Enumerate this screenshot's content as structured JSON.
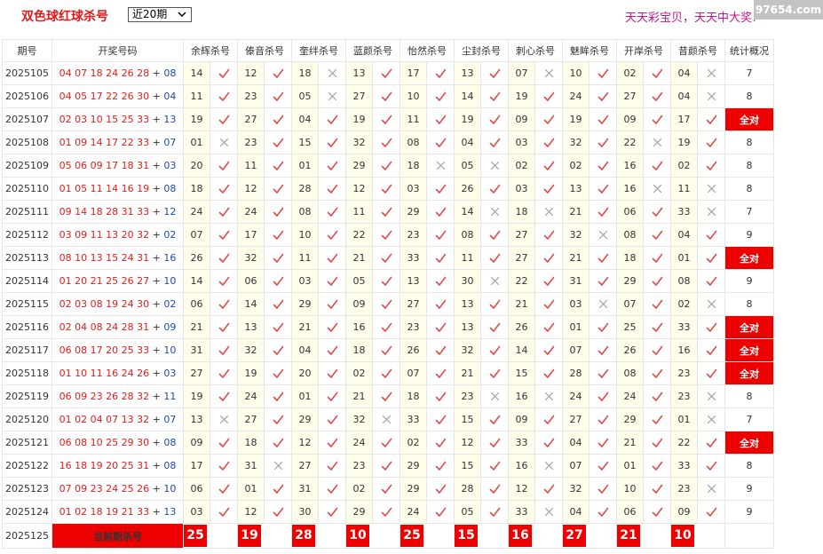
{
  "header": {
    "title": "双色球红球杀号",
    "period_select": "近20期",
    "ticker": "天天彩宝贝，天天中大奖!",
    "watermark": "97654.com"
  },
  "columns": [
    "期号",
    "开奖号码",
    "余辉杀号",
    "傣音杀号",
    "奎绊杀号",
    "蓝颜杀号",
    "怡然杀号",
    "尘封杀号",
    "刺心杀号",
    "魅眸杀号",
    "开岸杀号",
    "昔颜杀号",
    "统计概况"
  ],
  "rows": [
    {
      "issue": "2025105",
      "reds": "04 07 18 24 26 28",
      "blue": "08",
      "kills": [
        [
          "14",
          true
        ],
        [
          "12",
          true
        ],
        [
          "18",
          false
        ],
        [
          "13",
          true
        ],
        [
          "17",
          true
        ],
        [
          "13",
          true
        ],
        [
          "07",
          false
        ],
        [
          "10",
          true
        ],
        [
          "02",
          true
        ],
        [
          "04",
          false
        ]
      ],
      "stat": "7",
      "full": false
    },
    {
      "issue": "2025106",
      "reds": "04 05 17 22 26 30",
      "blue": "04",
      "kills": [
        [
          "11",
          true
        ],
        [
          "23",
          true
        ],
        [
          "05",
          false
        ],
        [
          "27",
          true
        ],
        [
          "10",
          true
        ],
        [
          "14",
          true
        ],
        [
          "19",
          true
        ],
        [
          "24",
          true
        ],
        [
          "27",
          true
        ],
        [
          "04",
          false
        ]
      ],
      "stat": "8",
      "full": false
    },
    {
      "issue": "2025107",
      "reds": "02 03 10 15 25 33",
      "blue": "13",
      "kills": [
        [
          "19",
          true
        ],
        [
          "27",
          true
        ],
        [
          "04",
          true
        ],
        [
          "19",
          true
        ],
        [
          "11",
          true
        ],
        [
          "19",
          true
        ],
        [
          "09",
          true
        ],
        [
          "19",
          true
        ],
        [
          "09",
          true
        ],
        [
          "17",
          true
        ]
      ],
      "stat": "全对",
      "full": true
    },
    {
      "issue": "2025108",
      "reds": "01 09 14 17 22 33",
      "blue": "07",
      "kills": [
        [
          "01",
          false
        ],
        [
          "23",
          true
        ],
        [
          "15",
          true
        ],
        [
          "32",
          true
        ],
        [
          "08",
          true
        ],
        [
          "04",
          true
        ],
        [
          "03",
          true
        ],
        [
          "32",
          true
        ],
        [
          "22",
          false
        ],
        [
          "19",
          true
        ]
      ],
      "stat": "8",
      "full": false
    },
    {
      "issue": "2025109",
      "reds": "05 06 09 17 18 31",
      "blue": "03",
      "kills": [
        [
          "20",
          true
        ],
        [
          "11",
          true
        ],
        [
          "01",
          true
        ],
        [
          "29",
          true
        ],
        [
          "18",
          false
        ],
        [
          "05",
          false
        ],
        [
          "02",
          true
        ],
        [
          "02",
          true
        ],
        [
          "16",
          true
        ],
        [
          "02",
          true
        ]
      ],
      "stat": "8",
      "full": false
    },
    {
      "issue": "2025110",
      "reds": "01 05 11 14 16 19",
      "blue": "08",
      "kills": [
        [
          "18",
          true
        ],
        [
          "12",
          true
        ],
        [
          "28",
          true
        ],
        [
          "12",
          true
        ],
        [
          "03",
          true
        ],
        [
          "26",
          true
        ],
        [
          "03",
          true
        ],
        [
          "13",
          true
        ],
        [
          "16",
          false
        ],
        [
          "11",
          false
        ]
      ],
      "stat": "8",
      "full": false
    },
    {
      "issue": "2025111",
      "reds": "09 14 18 28 31 33",
      "blue": "12",
      "kills": [
        [
          "24",
          true
        ],
        [
          "24",
          true
        ],
        [
          "08",
          true
        ],
        [
          "11",
          true
        ],
        [
          "29",
          true
        ],
        [
          "14",
          false
        ],
        [
          "18",
          false
        ],
        [
          "21",
          true
        ],
        [
          "06",
          true
        ],
        [
          "33",
          false
        ]
      ],
      "stat": "7",
      "full": false
    },
    {
      "issue": "2025112",
      "reds": "03 09 11 13 20 32",
      "blue": "02",
      "kills": [
        [
          "07",
          true
        ],
        [
          "17",
          true
        ],
        [
          "10",
          true
        ],
        [
          "22",
          true
        ],
        [
          "23",
          true
        ],
        [
          "08",
          true
        ],
        [
          "27",
          true
        ],
        [
          "32",
          false
        ],
        [
          "08",
          true
        ],
        [
          "04",
          true
        ]
      ],
      "stat": "9",
      "full": false
    },
    {
      "issue": "2025113",
      "reds": "08 10 13 15 24 31",
      "blue": "16",
      "kills": [
        [
          "26",
          true
        ],
        [
          "32",
          true
        ],
        [
          "11",
          true
        ],
        [
          "21",
          true
        ],
        [
          "33",
          true
        ],
        [
          "11",
          true
        ],
        [
          "27",
          true
        ],
        [
          "21",
          true
        ],
        [
          "18",
          true
        ],
        [
          "01",
          true
        ]
      ],
      "stat": "全对",
      "full": true
    },
    {
      "issue": "2025114",
      "reds": "01 20 21 25 26 27",
      "blue": "10",
      "kills": [
        [
          "14",
          true
        ],
        [
          "06",
          true
        ],
        [
          "03",
          true
        ],
        [
          "05",
          true
        ],
        [
          "13",
          true
        ],
        [
          "30",
          false
        ],
        [
          "22",
          true
        ],
        [
          "31",
          true
        ],
        [
          "29",
          true
        ],
        [
          "08",
          true
        ]
      ],
      "stat": "9",
      "full": false
    },
    {
      "issue": "2025115",
      "reds": "02 03 08 19 24 30",
      "blue": "02",
      "kills": [
        [
          "06",
          true
        ],
        [
          "14",
          true
        ],
        [
          "29",
          true
        ],
        [
          "09",
          true
        ],
        [
          "27",
          true
        ],
        [
          "13",
          true
        ],
        [
          "21",
          true
        ],
        [
          "03",
          false
        ],
        [
          "07",
          true
        ],
        [
          "02",
          false
        ]
      ],
      "stat": "8",
      "full": false
    },
    {
      "issue": "2025116",
      "reds": "02 04 08 24 28 31",
      "blue": "09",
      "kills": [
        [
          "21",
          true
        ],
        [
          "13",
          true
        ],
        [
          "21",
          true
        ],
        [
          "16",
          true
        ],
        [
          "23",
          true
        ],
        [
          "13",
          true
        ],
        [
          "26",
          true
        ],
        [
          "01",
          true
        ],
        [
          "25",
          true
        ],
        [
          "33",
          true
        ]
      ],
      "stat": "全对",
      "full": true
    },
    {
      "issue": "2025117",
      "reds": "06 08 17 20 25 33",
      "blue": "10",
      "kills": [
        [
          "31",
          true
        ],
        [
          "32",
          true
        ],
        [
          "04",
          true
        ],
        [
          "18",
          true
        ],
        [
          "26",
          true
        ],
        [
          "32",
          true
        ],
        [
          "14",
          true
        ],
        [
          "07",
          true
        ],
        [
          "26",
          true
        ],
        [
          "16",
          true
        ]
      ],
      "stat": "全对",
      "full": true
    },
    {
      "issue": "2025118",
      "reds": "01 10 11 16 24 26",
      "blue": "03",
      "kills": [
        [
          "27",
          true
        ],
        [
          "19",
          true
        ],
        [
          "20",
          true
        ],
        [
          "02",
          true
        ],
        [
          "07",
          true
        ],
        [
          "21",
          true
        ],
        [
          "15",
          true
        ],
        [
          "28",
          true
        ],
        [
          "08",
          true
        ],
        [
          "23",
          true
        ]
      ],
      "stat": "全对",
      "full": true
    },
    {
      "issue": "2025119",
      "reds": "06 09 23 26 28 32",
      "blue": "11",
      "kills": [
        [
          "19",
          true
        ],
        [
          "24",
          true
        ],
        [
          "01",
          true
        ],
        [
          "21",
          true
        ],
        [
          "18",
          true
        ],
        [
          "23",
          false
        ],
        [
          "16",
          false
        ],
        [
          "24",
          true
        ],
        [
          "24",
          true
        ],
        [
          "23",
          false
        ]
      ],
      "stat": "8",
      "full": false
    },
    {
      "issue": "2025120",
      "reds": "01 02 04 07 13 32",
      "blue": "07",
      "kills": [
        [
          "13",
          false
        ],
        [
          "27",
          true
        ],
        [
          "29",
          true
        ],
        [
          "32",
          false
        ],
        [
          "33",
          true
        ],
        [
          "15",
          true
        ],
        [
          "09",
          true
        ],
        [
          "27",
          true
        ],
        [
          "29",
          true
        ],
        [
          "01",
          false
        ]
      ],
      "stat": "7",
      "full": false
    },
    {
      "issue": "2025121",
      "reds": "06 08 10 25 29 30",
      "blue": "08",
      "kills": [
        [
          "09",
          true
        ],
        [
          "18",
          true
        ],
        [
          "12",
          true
        ],
        [
          "24",
          true
        ],
        [
          "02",
          true
        ],
        [
          "12",
          true
        ],
        [
          "33",
          true
        ],
        [
          "04",
          true
        ],
        [
          "21",
          true
        ],
        [
          "22",
          true
        ]
      ],
      "stat": "全对",
      "full": true
    },
    {
      "issue": "2025122",
      "reds": "16 18 19 20 25 31",
      "blue": "08",
      "kills": [
        [
          "17",
          true
        ],
        [
          "31",
          false
        ],
        [
          "27",
          true
        ],
        [
          "23",
          true
        ],
        [
          "29",
          true
        ],
        [
          "15",
          true
        ],
        [
          "16",
          false
        ],
        [
          "07",
          true
        ],
        [
          "01",
          true
        ],
        [
          "33",
          true
        ]
      ],
      "stat": "8",
      "full": false
    },
    {
      "issue": "2025123",
      "reds": "07 09 23 24 25 26",
      "blue": "10",
      "kills": [
        [
          "06",
          true
        ],
        [
          "01",
          true
        ],
        [
          "31",
          true
        ],
        [
          "02",
          true
        ],
        [
          "29",
          true
        ],
        [
          "28",
          true
        ],
        [
          "12",
          true
        ],
        [
          "32",
          true
        ],
        [
          "10",
          true
        ],
        [
          "23",
          false
        ]
      ],
      "stat": "9",
      "full": false
    },
    {
      "issue": "2025124",
      "reds": "01 02 18 19 21 33",
      "blue": "13",
      "kills": [
        [
          "03",
          true
        ],
        [
          "12",
          true
        ],
        [
          "30",
          true
        ],
        [
          "29",
          true
        ],
        [
          "24",
          true
        ],
        [
          "05",
          true
        ],
        [
          "33",
          false
        ],
        [
          "04",
          true
        ],
        [
          "06",
          true
        ],
        [
          "09",
          true
        ]
      ],
      "stat": "9",
      "full": false
    }
  ],
  "current": {
    "issue": "2025125",
    "label": "当前期杀号",
    "kills": [
      "25",
      "19",
      "28",
      "10",
      "25",
      "15",
      "16",
      "27",
      "21",
      "10"
    ]
  },
  "colors": {
    "red": "#e0201b",
    "blue": "#1f48b8",
    "highlight": "#ee0000",
    "kill_bg": "#fdfde9",
    "mark": "#e24b4b",
    "miss": "#a0a0a0"
  }
}
